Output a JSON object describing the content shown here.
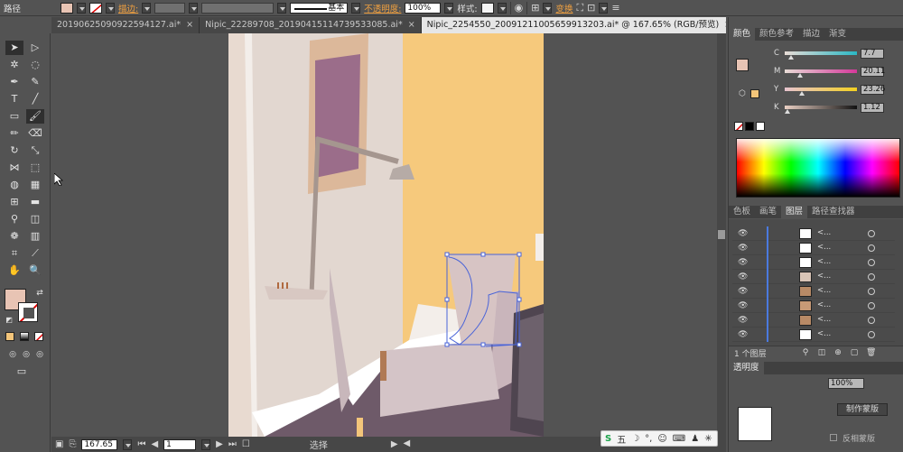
{
  "control_bar": {
    "object_type": "路径",
    "stroke_label": "描边:",
    "stroke_profile": "基本",
    "opacity_label": "不透明度:",
    "opacity_value": "100%",
    "style_label": "样式:",
    "transform_label": "变换",
    "fill_color": "#e8c4b4"
  },
  "tabs": [
    {
      "label": "20190625090922594127.ai*",
      "active": false
    },
    {
      "label": "Nipic_22289708_20190415114739533085.ai*",
      "active": false
    },
    {
      "label": "Nipic_2254550_20091211005659913203.ai* @ 167.65% (RGB/预览)",
      "active": true
    }
  ],
  "status_bar": {
    "zoom": "167.65",
    "page": "1",
    "tool_name": "选择"
  },
  "color_panel": {
    "tabs": [
      "颜色",
      "颜色参考",
      "描边",
      "渐变"
    ],
    "active_tab": "颜色",
    "channels": [
      {
        "name": "C",
        "value": "7.7",
        "fraction": 0.077
      },
      {
        "name": "M",
        "value": "20.11",
        "fraction": 0.2011
      },
      {
        "name": "Y",
        "value": "23.26",
        "fraction": 0.2326
      },
      {
        "name": "K",
        "value": "1.12",
        "fraction": 0.0112
      }
    ],
    "fill_color": "#e8c4b4",
    "stroke_color": "#f3c57a"
  },
  "layers_panel": {
    "tabs": [
      "色板",
      "画笔",
      "图层",
      "路径查找器"
    ],
    "active_tab": "图层",
    "rows": [
      {
        "name": "<..."
      },
      {
        "name": "<..."
      },
      {
        "name": "<..."
      },
      {
        "name": "<..."
      },
      {
        "name": "<..."
      },
      {
        "name": "<..."
      },
      {
        "name": "<..."
      },
      {
        "name": "<..."
      }
    ],
    "count_label": "1 个图层"
  },
  "transparency_panel": {
    "label": "透明度",
    "value": "100%",
    "make_mask": "制作蒙版",
    "invert_mask": "反相蒙版"
  },
  "ime_bar": {
    "label": "五"
  },
  "colors": {
    "wall_left": "#e2d7d0",
    "wall_right": "#f6c97c",
    "frame": "#dcb89a",
    "painting": "#9b6d8a",
    "lamp": "#a5968f",
    "floor": "#6e5a69",
    "chair": "#d4c4c7",
    "selection": "#4a64d8"
  }
}
